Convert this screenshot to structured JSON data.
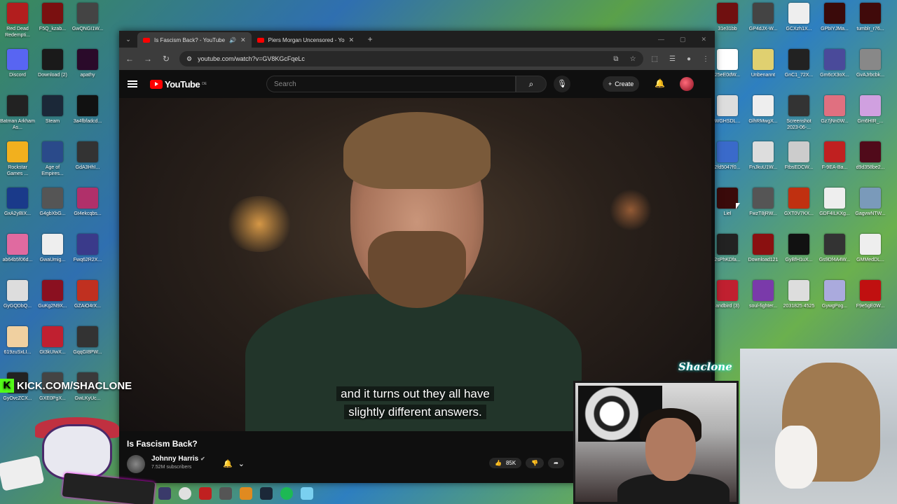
{
  "desktop_icons": [
    {
      "label": "Red Dead Redempti...",
      "color": "#b21e1e"
    },
    {
      "label": "F5Q_kzab...",
      "color": "#7a1010"
    },
    {
      "label": "GwQNGI1W...",
      "color": "#444444"
    },
    {
      "label": "Discord",
      "color": "#5865f2"
    },
    {
      "label": "Download (2)",
      "color": "#1a1a1a"
    },
    {
      "label": "apathy",
      "color": "#2a0a2a"
    },
    {
      "label": "Batman Arkham As...",
      "color": "#222222"
    },
    {
      "label": "Steam",
      "color": "#1b2838"
    },
    {
      "label": "3a4fbfadcd...",
      "color": "#111111"
    },
    {
      "label": "Rockstar Games ...",
      "color": "#f2b01e"
    },
    {
      "label": "Age of Empires...",
      "color": "#2a4a8a"
    },
    {
      "label": "GdA3HhI...",
      "color": "#333333"
    },
    {
      "label": "GxA2yBIX...",
      "color": "#1a3a8a"
    },
    {
      "label": "G4gbXbG...",
      "color": "#555555"
    },
    {
      "label": "Gt4ekcqbs...",
      "color": "#b0306a"
    },
    {
      "label": "ab64b5f06d...",
      "color": "#e06aa0"
    },
    {
      "label": "GwaUmig...",
      "color": "#eeeeee"
    },
    {
      "label": "Fwq62R2X...",
      "color": "#3a3a8a"
    },
    {
      "label": "GyGQDbQ...",
      "color": "#dddddd"
    },
    {
      "label": "GuKg2N9X...",
      "color": "#8a1020"
    },
    {
      "label": "GZAiO4rX...",
      "color": "#c03020"
    },
    {
      "label": "619zuSxLI...",
      "color": "#f0d0a0"
    },
    {
      "label": "Gt3kUIwX...",
      "color": "#c02030"
    },
    {
      "label": "GqqGI8PW...",
      "color": "#333333"
    },
    {
      "label": "GyOvcZCX...",
      "color": "#222222"
    },
    {
      "label": "GXE0PgX...",
      "color": "#444444"
    },
    {
      "label": "GwLKyUc...",
      "color": "#3a3a3a"
    }
  ],
  "right_icons": [
    {
      "label": "31e31bb",
      "color": "#701010"
    },
    {
      "label": "GP4dJX-W...",
      "color": "#444444"
    },
    {
      "label": "GCXzh1X...",
      "color": "#eeeeee"
    },
    {
      "label": "GPbIYJMa...",
      "color": "#3a0a0a"
    },
    {
      "label": "tumblr_r76...",
      "color": "#400a0a"
    },
    {
      "label": "25eE0dW...",
      "color": "#ffffff"
    },
    {
      "label": "Unbenannt",
      "color": "#e0d070"
    },
    {
      "label": "GnC1_72X...",
      "color": "#222222"
    },
    {
      "label": "Gm6cX3oX...",
      "color": "#4a4a9a"
    },
    {
      "label": "GvAJrbcbk...",
      "color": "#888888"
    },
    {
      "label": "WGHSDL...",
      "color": "#dddddd"
    },
    {
      "label": "GlhRMwgX...",
      "color": "#eeeeee"
    },
    {
      "label": "Screenshot 2023-06-...",
      "color": "#333333"
    },
    {
      "label": "Gz7jNn0W...",
      "color": "#e07080"
    },
    {
      "label": "Gm6HIR_...",
      "color": "#d0a0e0"
    },
    {
      "label": "2fd5047f0...",
      "color": "#3a6aca"
    },
    {
      "label": "FnJkuU1W...",
      "color": "#dddddd"
    },
    {
      "label": "FtbsEDCW...",
      "color": "#cccccc"
    },
    {
      "label": "F-9EA-Ba...",
      "color": "#c02020"
    },
    {
      "label": "d9d358be2...",
      "color": "#500a1a"
    },
    {
      "label": "Liel",
      "color": "#3a0a0a"
    },
    {
      "label": "FwzT8jRW...",
      "color": "#555555"
    },
    {
      "label": "GXT0V7KX...",
      "color": "#c03010"
    },
    {
      "label": "GDF4ILKXg...",
      "color": "#eeeeee"
    },
    {
      "label": "GagvwNTW...",
      "color": "#7a9aba"
    },
    {
      "label": "2sPhKDfa...",
      "color": "#222222"
    },
    {
      "label": "Download121",
      "color": "#8a1010"
    },
    {
      "label": "GyBfH1uX...",
      "color": "#111111"
    },
    {
      "label": "Gs9Df4A4W...",
      "color": "#333333"
    },
    {
      "label": "GMMedDL...",
      "color": "#eeeeee"
    },
    {
      "label": "andbird (3)",
      "color": "#c02030"
    },
    {
      "label": "soul-fighter...",
      "color": "#7a3aaa"
    },
    {
      "label": "2031825 4525",
      "color": "#dddddd"
    },
    {
      "label": "GywgPog...",
      "color": "#aaaadd"
    },
    {
      "label": "F9e5gE0W...",
      "color": "#c01010"
    }
  ],
  "browser": {
    "tabs": [
      {
        "title": "Is Fascism Back? - YouTube",
        "active": true
      },
      {
        "title": "Piers Morgan Uncensored - Yo",
        "active": false
      }
    ],
    "url": "youtube.com/watch?v=GV8KGcFqeLc"
  },
  "youtube": {
    "logo_text": "YouTube",
    "logo_country": "DE",
    "search_placeholder": "Search",
    "create_label": "Create",
    "subtitle_line1": "and it turns out they all have",
    "subtitle_line2": "slightly different answers.",
    "video_title": "Is Fascism Back?",
    "channel_name": "Johnny Harris",
    "subscribers": "7.52M subscribers",
    "like_count": "85K"
  },
  "overlays": {
    "kick_text": "KICK.COM/SHACLONE",
    "brand_name": "Shaclone"
  },
  "taskbar_icons": [
    "app-icon",
    "chrome-icon",
    "red-app-icon",
    "game-icon",
    "java-icon",
    "steam-icon",
    "spotify-icon",
    "notepad-icon"
  ]
}
